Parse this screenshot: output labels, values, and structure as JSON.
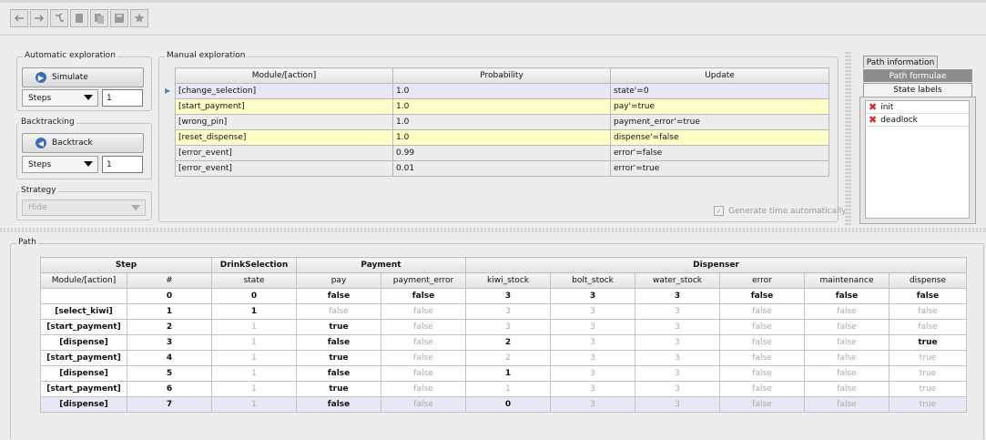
{
  "toolbar": {
    "buttons": [
      "undo-icon",
      "redo-icon",
      "tree-icon",
      "copy-icon",
      "paste-icon",
      "save-icon",
      "star-icon"
    ]
  },
  "auto": {
    "legend": "Automatic exploration",
    "simulate": "Simulate",
    "steps_label": "Steps",
    "steps_value": "1"
  },
  "backtracking": {
    "legend": "Backtracking",
    "backtrack": "Backtrack",
    "steps_label": "Steps",
    "steps_value": "1"
  },
  "strategy": {
    "legend": "Strategy",
    "value": "Hide"
  },
  "manual": {
    "legend": "Manual exploration",
    "headers": [
      "Module/[action]",
      "Probability",
      "Update"
    ],
    "rows": [
      {
        "action": "[change_selection]",
        "prob": "1.0",
        "update": "state'=0"
      },
      {
        "action": "[start_payment]",
        "prob": "1.0",
        "update": "pay'=true"
      },
      {
        "action": "[wrong_pin]",
        "prob": "1.0",
        "update": "payment_error'=true"
      },
      {
        "action": "[reset_dispense]",
        "prob": "1.0",
        "update": "dispense'=false"
      },
      {
        "action": "[error_event]",
        "prob": "0.99",
        "update": "error'=false"
      },
      {
        "action": "[error_event]",
        "prob": "0.01",
        "update": "error'=true"
      }
    ],
    "generate_time": "Generate time automatically"
  },
  "side": {
    "tabs": [
      "Path information",
      "Path formulae",
      "State labels"
    ],
    "labels": [
      "init",
      "deadlock"
    ]
  },
  "path": {
    "legend": "Path",
    "groups": [
      "Step",
      "DrinkSelection",
      "Payment",
      "Dispenser"
    ],
    "columns": [
      "Module/[action]",
      "#",
      "state",
      "pay",
      "payment_error",
      "kiwi_stock",
      "bolt_stock",
      "water_stock",
      "error",
      "maintenance",
      "dispense"
    ],
    "rows": [
      [
        "",
        "0",
        "0",
        "false",
        "false",
        "3",
        "3",
        "3",
        "false",
        "false",
        "false"
      ],
      [
        "[select_kiwi]",
        "1",
        "1",
        "false",
        "false",
        "3",
        "3",
        "3",
        "false",
        "false",
        "false"
      ],
      [
        "[start_payment]",
        "2",
        "1",
        "true",
        "false",
        "3",
        "3",
        "3",
        "false",
        "false",
        "false"
      ],
      [
        "[dispense]",
        "3",
        "1",
        "false",
        "false",
        "2",
        "3",
        "3",
        "false",
        "false",
        "true"
      ],
      [
        "[start_payment]",
        "4",
        "1",
        "true",
        "false",
        "2",
        "3",
        "3",
        "false",
        "false",
        "true"
      ],
      [
        "[dispense]",
        "5",
        "1",
        "false",
        "false",
        "1",
        "3",
        "3",
        "false",
        "false",
        "true"
      ],
      [
        "[start_payment]",
        "6",
        "1",
        "true",
        "false",
        "1",
        "3",
        "3",
        "false",
        "false",
        "true"
      ],
      [
        "[dispense]",
        "7",
        "1",
        "false",
        "false",
        "0",
        "3",
        "3",
        "false",
        "false",
        "true"
      ]
    ]
  }
}
